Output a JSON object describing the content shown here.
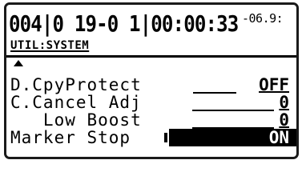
{
  "status": {
    "main": "004|0 19-0 1|00:00:33",
    "suffix": "-06.9:"
  },
  "menu_path": "UTIL:SYSTEM",
  "params": [
    {
      "label": "D.CpyProtect",
      "value": "OFF"
    },
    {
      "label": "C.Cancel Adj",
      "value": "0"
    },
    {
      "label": "   Low Boost",
      "value": "0"
    },
    {
      "label": "Marker Stop",
      "value": "ON"
    }
  ],
  "icons": {
    "scroll_up": "triangle-up-icon"
  }
}
